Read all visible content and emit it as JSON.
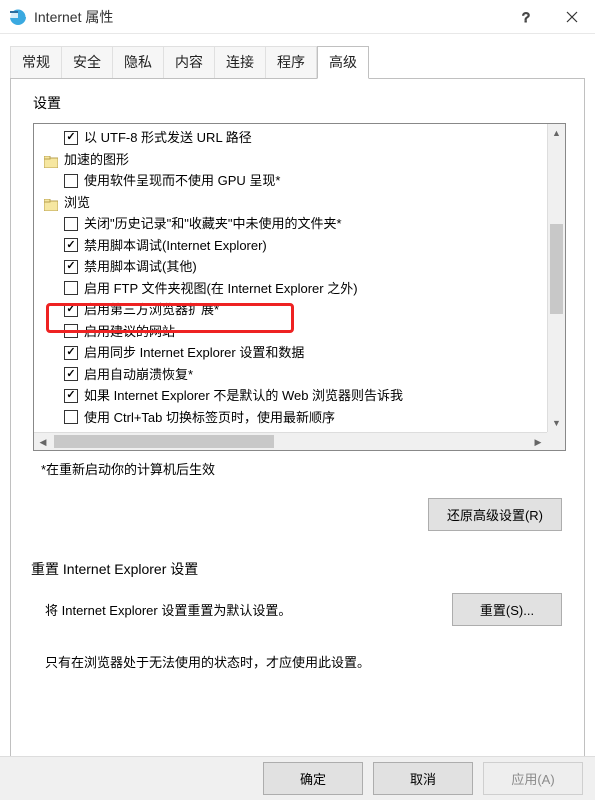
{
  "window": {
    "title": "Internet 属性"
  },
  "tabs": {
    "items": [
      {
        "label": "常规"
      },
      {
        "label": "安全"
      },
      {
        "label": "隐私"
      },
      {
        "label": "内容"
      },
      {
        "label": "连接"
      },
      {
        "label": "程序"
      },
      {
        "label": "高级"
      }
    ],
    "activeIndex": 6
  },
  "settings_label": "设置",
  "tree": [
    {
      "kind": "check",
      "indent": 2,
      "checked": true,
      "label": "以 UTF-8 形式发送 URL 路径"
    },
    {
      "kind": "section",
      "indent": 1,
      "checked": false,
      "label": "加速的图形"
    },
    {
      "kind": "check",
      "indent": 2,
      "checked": false,
      "label": "使用软件呈现而不使用 GPU 呈现*"
    },
    {
      "kind": "section",
      "indent": 1,
      "checked": false,
      "label": "浏览"
    },
    {
      "kind": "check",
      "indent": 2,
      "checked": false,
      "label": "关闭\"历史记录\"和\"收藏夹\"中未使用的文件夹*"
    },
    {
      "kind": "check",
      "indent": 2,
      "checked": true,
      "label": "禁用脚本调试(Internet Explorer)"
    },
    {
      "kind": "check",
      "indent": 2,
      "checked": true,
      "label": "禁用脚本调试(其他)"
    },
    {
      "kind": "check",
      "indent": 2,
      "checked": false,
      "label": "启用 FTP 文件夹视图(在 Internet Explorer 之外)"
    },
    {
      "kind": "check",
      "indent": 2,
      "checked": true,
      "label": "启用第三方浏览器扩展*"
    },
    {
      "kind": "check",
      "indent": 2,
      "checked": false,
      "label": "启用建议的网站"
    },
    {
      "kind": "check",
      "indent": 2,
      "checked": true,
      "label": "启用同步 Internet Explorer 设置和数据"
    },
    {
      "kind": "check",
      "indent": 2,
      "checked": true,
      "label": "启用自动崩溃恢复*"
    },
    {
      "kind": "check",
      "indent": 2,
      "checked": true,
      "label": "如果 Internet Explorer 不是默认的 Web 浏览器则告诉我"
    },
    {
      "kind": "check",
      "indent": 2,
      "checked": false,
      "label": "使用 Ctrl+Tab 切换标签页时，使用最新顺序"
    }
  ],
  "note": "*在重新启动你的计算机后生效",
  "restore_button": "还原高级设置(R)",
  "reset": {
    "heading": "重置 Internet Explorer 设置",
    "desc": "将 Internet Explorer 设置重置为默认设置。",
    "button": "重置(S)...",
    "info": "只有在浏览器处于无法使用的状态时，才应使用此设置。"
  },
  "footer": {
    "ok": "确定",
    "cancel": "取消",
    "apply": "应用(A)"
  }
}
